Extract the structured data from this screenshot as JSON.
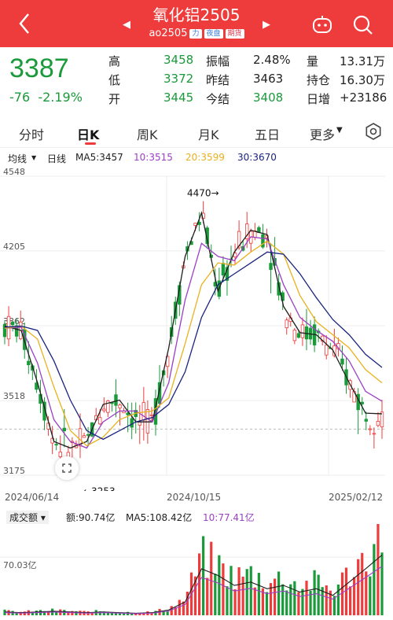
{
  "header": {
    "title": "氧化铝2505",
    "code": "ao2505",
    "tags": [
      "力",
      "夜盘",
      "期货"
    ],
    "back_icon": "chevron-left-icon",
    "robot_icon": "robot-assistant-icon",
    "search_icon": "search-icon"
  },
  "quote": {
    "price": "3387",
    "change": "-76",
    "change_pct": "-2.19%",
    "rows": [
      {
        "l1": "高",
        "v1": "3458",
        "l2": "振幅",
        "v2": "2.48%",
        "l3": "量",
        "v3": "13.31万"
      },
      {
        "l1": "低",
        "v1": "3372",
        "l2": "昨结",
        "v2": "3463",
        "l3": "持仓",
        "v3": "16.30万"
      },
      {
        "l1": "开",
        "v1": "3445",
        "l2": "今结",
        "v2": "3408",
        "l3": "日增",
        "v3": "+23186"
      }
    ]
  },
  "tabs": [
    "分时",
    "日K",
    "周K",
    "月K",
    "五日",
    "更多"
  ],
  "active_tab": "日K",
  "indicators": {
    "type": "均线",
    "period": "日线",
    "ma5": "MA5:3457",
    "ma10": "10:3515",
    "ma20": "20:3599",
    "ma30": "30:3670"
  },
  "price_axis": [
    "4548",
    "4205",
    "3862",
    "3518",
    "3175"
  ],
  "annotations": {
    "high": "4470→",
    "low": "←3253"
  },
  "dates": [
    "2024/06/14",
    "2024/10/15",
    "2025/02/12"
  ],
  "volume": {
    "label": "成交额",
    "amount": "额:90.74亿",
    "ma5": "MA5:108.42亿",
    "ma10": "10:77.41亿",
    "axis": "70.03亿"
  },
  "colors": {
    "up": "#ee3b3b",
    "down": "#1a9a3a",
    "ma5": "#1f1f1f",
    "ma10": "#9b3fc4",
    "ma20": "#e8b21f",
    "ma30": "#1a237e"
  },
  "chart_data": {
    "type": "line",
    "title": "",
    "xlabel": "",
    "ylabel": "",
    "ylim": [
      3175,
      4548
    ],
    "x": [
      "2024/06/14",
      "2024/10/15",
      "2025/02/12"
    ],
    "series": [
      {
        "name": "MA5",
        "values": [
          3860,
          3840,
          3600,
          3330,
          3300,
          3330,
          3500,
          3520,
          3420,
          3420,
          3760,
          4180,
          4380,
          4020,
          4200,
          4300,
          4280,
          3950,
          3830,
          3820,
          3750,
          3600,
          3460,
          3457
        ]
      },
      {
        "name": "10",
        "values": [
          3850,
          3855,
          3690,
          3430,
          3330,
          3300,
          3420,
          3470,
          3470,
          3420,
          3600,
          3980,
          4240,
          4180,
          4160,
          4270,
          4260,
          4050,
          3900,
          3840,
          3790,
          3700,
          3560,
          3515
        ]
      },
      {
        "name": "20",
        "values": [
          3850,
          3860,
          3800,
          3580,
          3380,
          3310,
          3350,
          3430,
          3460,
          3470,
          3530,
          3780,
          4050,
          4150,
          4140,
          4200,
          4250,
          4190,
          4000,
          3880,
          3820,
          3760,
          3660,
          3599
        ]
      },
      {
        "name": "30",
        "values": [
          3855,
          3860,
          3840,
          3700,
          3520,
          3380,
          3340,
          3380,
          3420,
          3440,
          3500,
          3650,
          3900,
          4050,
          4100,
          4150,
          4200,
          4190,
          4100,
          3990,
          3890,
          3820,
          3730,
          3670
        ]
      }
    ],
    "volume_values": [
      5,
      4,
      5,
      6,
      5,
      4,
      5,
      4,
      3,
      4,
      8,
      20,
      70,
      60,
      45,
      50,
      40,
      45,
      35,
      40,
      30,
      50,
      70,
      90.74
    ]
  }
}
